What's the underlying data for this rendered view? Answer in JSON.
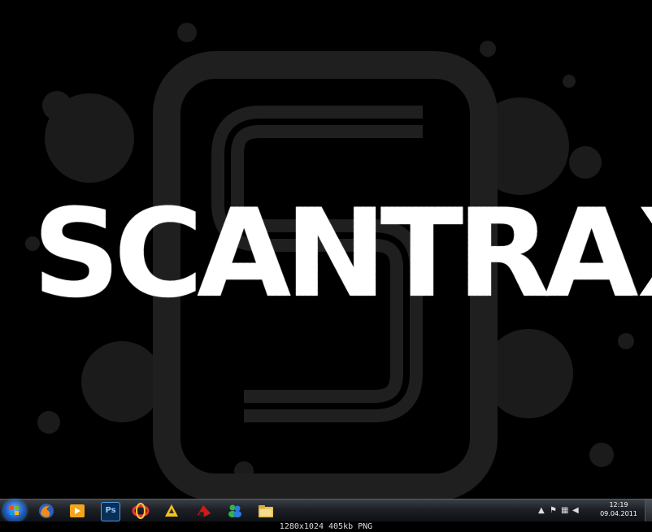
{
  "desktop": {
    "wallpaper_logo": {
      "grungy_text": "SCANTRA",
      "solid_text": "XX"
    },
    "colors": {
      "background": "#000000",
      "emblem": "#1f1f1f",
      "logo": "#ffffff"
    }
  },
  "taskbar": {
    "start_icon": "windows-start-orb",
    "pinned": [
      {
        "name": "firefox-icon"
      },
      {
        "name": "media-player-icon"
      },
      {
        "name": "photoshop-icon",
        "label": "Ps"
      },
      {
        "name": "app-swirl-icon"
      },
      {
        "name": "winamp-icon"
      },
      {
        "name": "app-red-icon"
      },
      {
        "name": "messenger-icon"
      },
      {
        "name": "explorer-folder-icon"
      }
    ],
    "tray": {
      "icons": [
        "chevron-up-icon",
        "flag-icon",
        "network-icon",
        "volume-icon"
      ],
      "time": "12:19",
      "date": "09.04.2011"
    }
  },
  "info_bar": {
    "text": "1280x1024 405kb PNG"
  }
}
